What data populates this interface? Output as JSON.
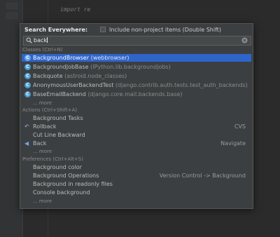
{
  "editor": {
    "code_line": "import re"
  },
  "popup": {
    "title": "Search Everywhere:",
    "include_label": "Include non-project items (Double Shift)",
    "search_value": "back",
    "icons": {
      "search": "search-icon",
      "clear": "clear-icon",
      "class": "class-icon",
      "action": "action-icon"
    }
  },
  "classes": {
    "header": "Classes (Ctrl+N)",
    "items": [
      {
        "name": "BackgroundBrowser",
        "pkg": "(webbrowser)",
        "selected": true
      },
      {
        "name": "BackgroundJobBase",
        "pkg": "(IPython.lib.backgroundjobs)"
      },
      {
        "name": "Backquote",
        "pkg": "(astroid.node_classes)"
      },
      {
        "name": "AnonymousUserBackendTest",
        "pkg": "(django.contrib.auth.tests.test_auth_backends)"
      },
      {
        "name": "BaseEmailBackend",
        "pkg": "(django.core.mail.backends.base)"
      }
    ],
    "more": "... more"
  },
  "actions": {
    "header": "Actions (Ctrl+Shift+A)",
    "items": [
      {
        "name": "Background Tasks",
        "shortcut": ""
      },
      {
        "name": "Rollback",
        "shortcut": "CVS"
      },
      {
        "name": "Cut Line Backward",
        "shortcut": ""
      },
      {
        "name": "Back",
        "shortcut": "Navigate"
      }
    ],
    "more": "... more"
  },
  "preferences": {
    "header": "Preferences (Ctrl+Alt+S)",
    "items": [
      {
        "name": "Background color",
        "location": ""
      },
      {
        "name": "Background Operations",
        "location": "Version Control -> Background"
      },
      {
        "name": "Background in readonly files",
        "location": ""
      },
      {
        "name": "Console background",
        "location": ""
      }
    ],
    "more": "... more"
  },
  "colors": {
    "selection": "#2f65ca",
    "popup_bg": "#3c3f41",
    "editor_bg": "#2b2b2b"
  }
}
